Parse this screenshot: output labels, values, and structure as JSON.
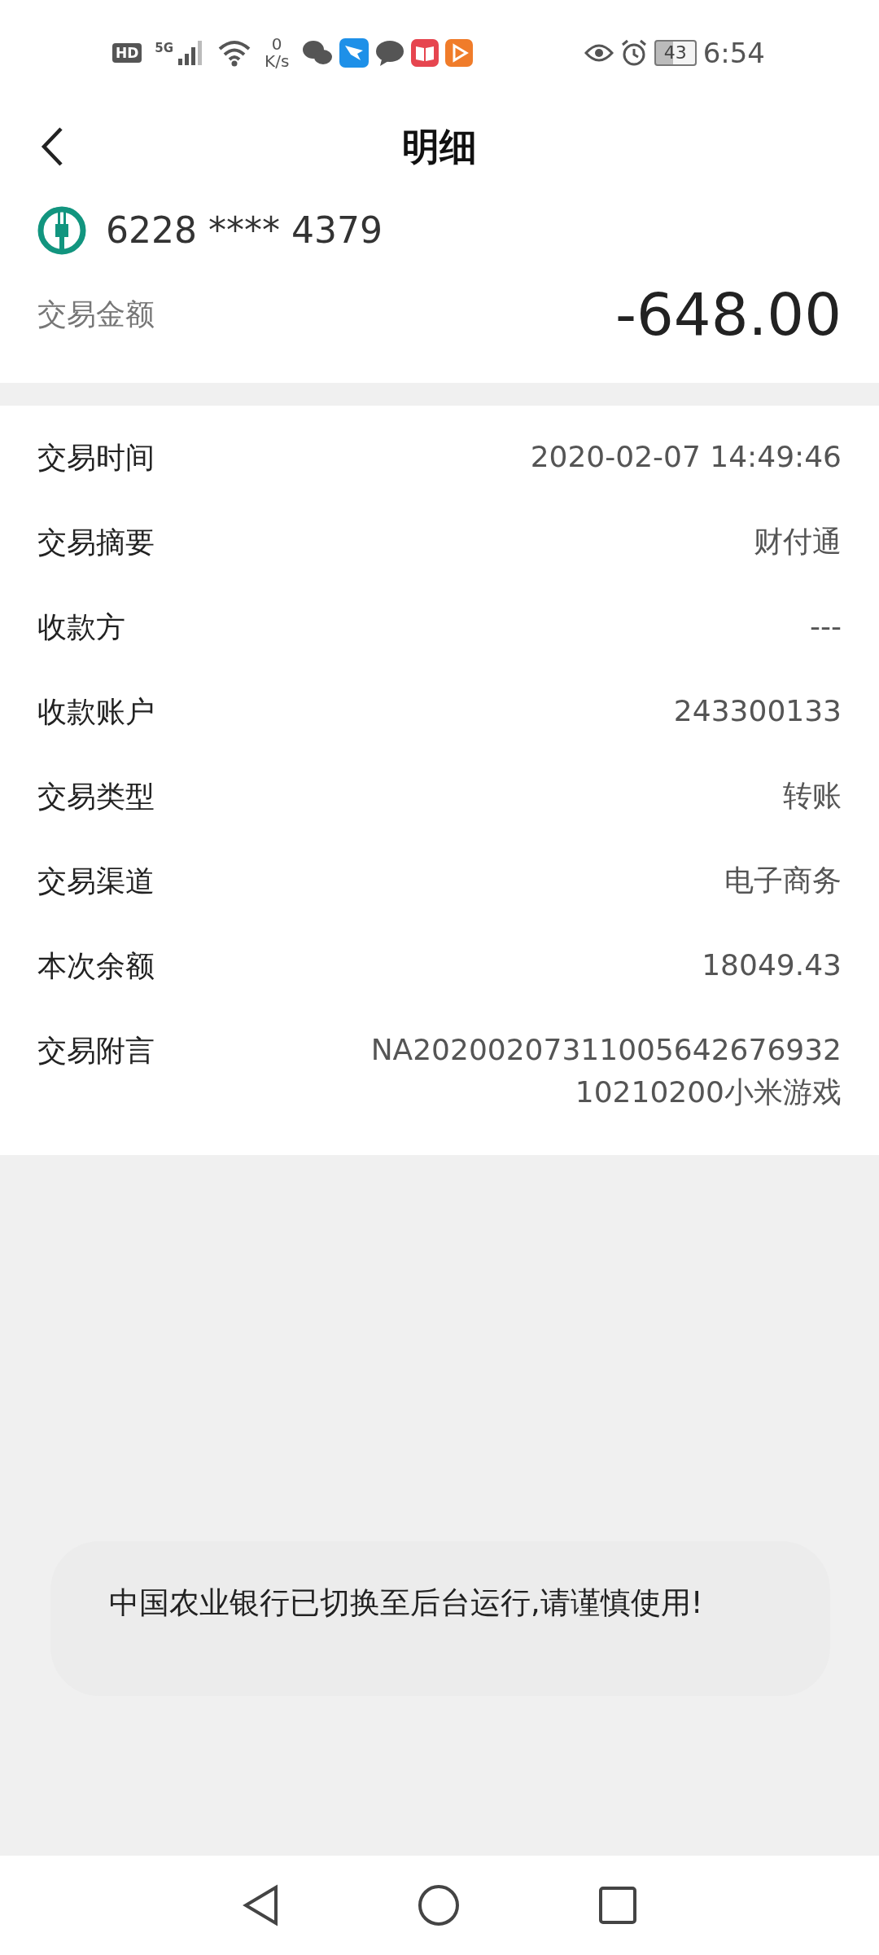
{
  "status_bar": {
    "hd": "HD",
    "network": "5G",
    "speed_value": "0",
    "speed_unit": "K/s",
    "battery": "43",
    "time": "6:54"
  },
  "header": {
    "title": "明细"
  },
  "account": {
    "card_number": "6228 **** 4379",
    "amount_label": "交易金额",
    "amount": "-648.00"
  },
  "details": [
    {
      "label": "交易时间",
      "value": "2020-02-07 14:49:46"
    },
    {
      "label": "交易摘要",
      "value": "财付通"
    },
    {
      "label": "收款方",
      "value": "---"
    },
    {
      "label": "收款账户",
      "value": "243300133"
    },
    {
      "label": "交易类型",
      "value": "转账"
    },
    {
      "label": "交易渠道",
      "value": "电子商务"
    },
    {
      "label": "本次余额",
      "value": "18049.43"
    },
    {
      "label": "交易附言",
      "value": "NA2020020731100564267693210210200小米游戏"
    }
  ],
  "toast": {
    "message": "中国农业银行已切换至后台运行,请谨慎使用!"
  }
}
